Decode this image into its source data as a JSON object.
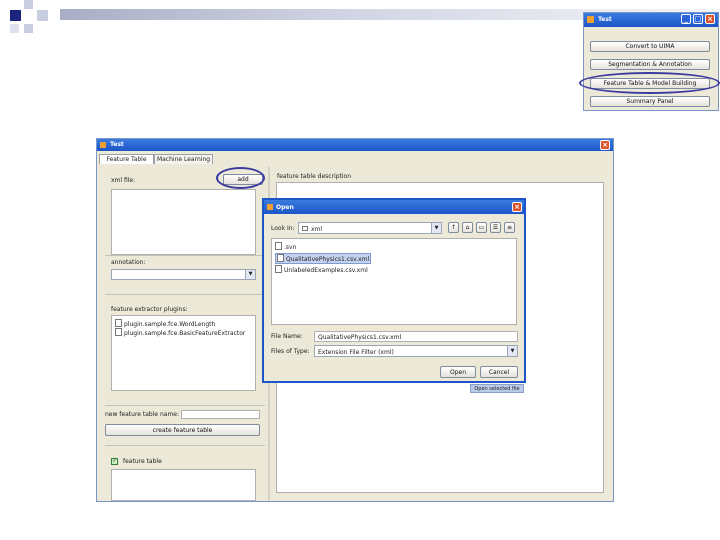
{
  "main_window": {
    "title": "Test",
    "tabs": [
      {
        "label": "Feature Table",
        "active": true
      },
      {
        "label": "Machine Learning",
        "active": false
      }
    ],
    "xml_file_label": "xml file:",
    "add_button": "add",
    "annotation_label": "annotation:",
    "plugins_label": "feature extractor plugins:",
    "plugins": [
      "plugin.sample.fce.WordLength",
      "plugin.sample.fce.BasicFeatureExtractor"
    ],
    "new_table_label": "new feature table name:",
    "new_table_value": "",
    "create_button": "create feature table",
    "feature_table_label": "feature table",
    "description_label": "feature table description"
  },
  "open_dialog": {
    "title": "Open",
    "look_in_label": "Look In:",
    "look_in_value": "xml",
    "files": [
      {
        "name": ".svn",
        "type": "folder",
        "selected": false
      },
      {
        "name": "QualitativePhysics1.csv.xml",
        "type": "file",
        "selected": true
      },
      {
        "name": "UnlabeledExamples.csv.xml",
        "type": "file",
        "selected": false
      }
    ],
    "file_name_label": "File Name:",
    "file_name_value": "QualitativePhysics1.csv.xml",
    "file_type_label": "Files of Type:",
    "file_type_value": "Extension File Filter (xml)",
    "open_button": "Open",
    "cancel_button": "Cancel",
    "tooltip": "Open selected file"
  },
  "mini_window": {
    "title": "Test",
    "buttons": [
      "Convert to UIMA",
      "Segmentation & Annotation",
      "Feature Table & Model Building",
      "Summary Panel"
    ]
  },
  "colors": {
    "xp_title": "#1d55c8",
    "window_bg": "#ece9d8",
    "highlight_ring": "#3a3aa0",
    "selection": "#c3d1ef"
  }
}
